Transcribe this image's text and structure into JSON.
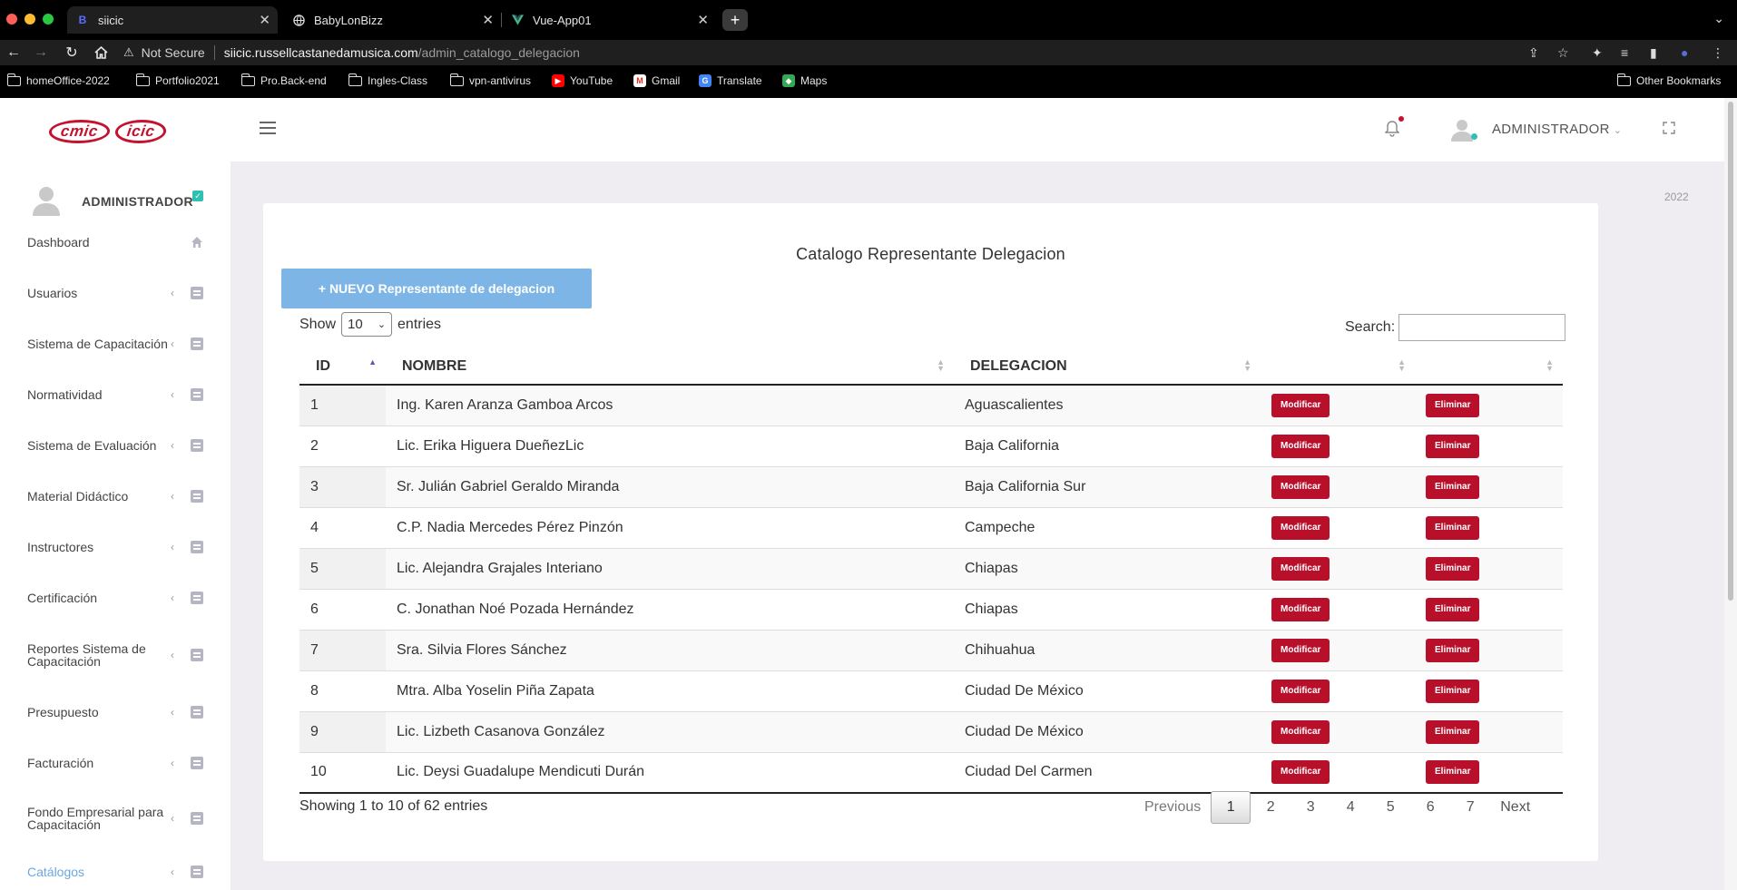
{
  "browser": {
    "tabs": [
      {
        "title": "siicic",
        "icon": "bootstrap-icon",
        "active": true
      },
      {
        "title": "BabyLonBizz",
        "icon": "globe-icon",
        "active": false
      },
      {
        "title": "Vue-App01",
        "icon": "vue-icon",
        "active": false
      }
    ],
    "address": {
      "security": "Not Secure",
      "host": "siicic.russellcastanedamusica.com",
      "path": "/admin_catalogo_delegacion"
    },
    "bookmarks": [
      {
        "label": "homeOffice-2022",
        "icon": "folder-icon"
      },
      {
        "label": "Portfolio2021",
        "icon": "folder-icon"
      },
      {
        "label": "Pro.Back-end",
        "icon": "folder-icon"
      },
      {
        "label": "Ingles-Class",
        "icon": "folder-icon"
      },
      {
        "label": "vpn-antivirus",
        "icon": "folder-icon"
      },
      {
        "label": "YouTube",
        "icon": "youtube-icon"
      },
      {
        "label": "Gmail",
        "icon": "gmail-icon"
      },
      {
        "label": "Translate",
        "icon": "translate-icon"
      },
      {
        "label": "Maps",
        "icon": "maps-icon"
      }
    ],
    "other_bookmarks": "Other Bookmarks"
  },
  "header": {
    "logo": [
      "cmic",
      "icic"
    ],
    "user": "ADMINISTRADOR",
    "accent": "#c4122f"
  },
  "sidebar": {
    "user": "ADMINISTRADOR",
    "items": [
      {
        "label": "Dashboard",
        "icon": "home-icon",
        "has_arrow": false
      },
      {
        "label": "Usuarios",
        "icon": "list-icon",
        "has_arrow": true
      },
      {
        "label": "Sistema de Capacitación",
        "icon": "list-icon",
        "has_arrow": true
      },
      {
        "label": "Normatividad",
        "icon": "list-icon",
        "has_arrow": true
      },
      {
        "label": "Sistema de Evaluación",
        "icon": "list-icon",
        "has_arrow": true
      },
      {
        "label": "Material Didáctico",
        "icon": "list-icon",
        "has_arrow": true
      },
      {
        "label": "Instructores",
        "icon": "list-icon",
        "has_arrow": true
      },
      {
        "label": "Certificación",
        "icon": "list-icon",
        "has_arrow": true
      },
      {
        "label": "Reportes Sistema de Capacitación",
        "icon": "list-icon",
        "has_arrow": true
      },
      {
        "label": "Presupuesto",
        "icon": "list-icon",
        "has_arrow": true
      },
      {
        "label": "Facturación",
        "icon": "list-icon",
        "has_arrow": true
      },
      {
        "label": "Fondo Empresarial para Capacitación",
        "icon": "list-icon",
        "has_arrow": true
      },
      {
        "label": "Catálogos",
        "icon": "list-icon",
        "has_arrow": true
      }
    ]
  },
  "main": {
    "year": "2022",
    "title": "Catalogo Representante Delegacion",
    "new_button": "+ NUEVO Representante de delegacion",
    "show_label": "Show",
    "entries_value": "10",
    "entries_label": "entries",
    "search_label": "Search:",
    "search_value": "",
    "columns": [
      "ID",
      "NOMBRE",
      "DELEGACION",
      "",
      ""
    ],
    "action_modify": "Modificar",
    "action_delete": "Eliminar",
    "rows": [
      {
        "id": "1",
        "nombre": "Ing. Karen Aranza Gamboa Arcos",
        "delegacion": "Aguascalientes"
      },
      {
        "id": "2",
        "nombre": "Lic. Erika Higuera DueñezLic",
        "delegacion": "Baja California"
      },
      {
        "id": "3",
        "nombre": "Sr. Julián Gabriel Geraldo Miranda",
        "delegacion": "Baja California Sur"
      },
      {
        "id": "4",
        "nombre": "C.P. Nadia Mercedes Pérez Pinzón",
        "delegacion": "Campeche"
      },
      {
        "id": "5",
        "nombre": "Lic. Alejandra Grajales Interiano",
        "delegacion": "Chiapas"
      },
      {
        "id": "6",
        "nombre": "C. Jonathan Noé Pozada Hernández",
        "delegacion": "Chiapas"
      },
      {
        "id": "7",
        "nombre": "Sra. Silvia Flores Sánchez",
        "delegacion": "Chihuahua"
      },
      {
        "id": "8",
        "nombre": "Mtra. Alba Yoselin Piña Zapata",
        "delegacion": "Ciudad De México"
      },
      {
        "id": "9",
        "nombre": "Lic. Lizbeth Casanova González",
        "delegacion": "Ciudad De México"
      },
      {
        "id": "10",
        "nombre": "Lic. Deysi Guadalupe Mendicuti Durán",
        "delegacion": "Ciudad Del Carmen"
      }
    ],
    "info": "Showing 1 to 10 of 62 entries",
    "pagination": {
      "previous": "Previous",
      "pages": [
        "1",
        "2",
        "3",
        "4",
        "5",
        "6",
        "7"
      ],
      "current": "1",
      "next": "Next"
    }
  }
}
